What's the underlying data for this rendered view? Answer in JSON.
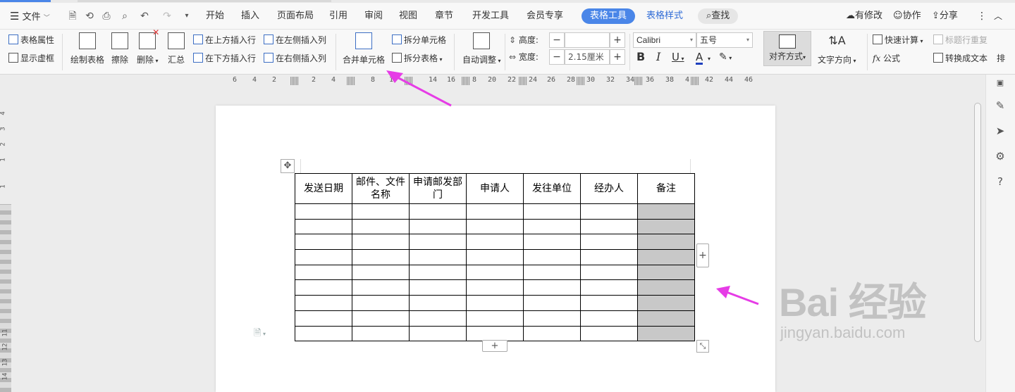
{
  "menubar": {
    "file": "文件",
    "tabs": [
      "开始",
      "插入",
      "页面布局",
      "引用",
      "审阅",
      "视图",
      "章节",
      "开发工具",
      "会员专享"
    ],
    "active_tab": "表格工具",
    "table_style_tab": "表格样式",
    "search": "查找",
    "right": {
      "modified": "有修改",
      "collab": "协作",
      "share": "分享"
    }
  },
  "ribbon": {
    "table_props": "表格属性",
    "show_grid": "显示虚框",
    "draw_table": "绘制表格",
    "erase": "擦除",
    "delete": "删除",
    "summary": "汇总",
    "insert_row_above": "在上方插入行",
    "insert_row_below": "在下方插入行",
    "insert_col_left": "在左侧插入列",
    "insert_col_right": "在右侧插入列",
    "merge_cells": "合并单元格",
    "split_cells": "拆分单元格",
    "split_table": "拆分表格",
    "auto_fit": "自动调整",
    "height_label": "高度:",
    "height_value": "",
    "width_label": "宽度:",
    "width_value": "2.15厘米",
    "font_name": "Calibri",
    "font_size": "五号",
    "align": "对齐方式",
    "text_dir": "文字方向",
    "quick_calc": "快速计算",
    "title_repeat": "标题行重复",
    "formula": "公式",
    "convert_text": "转换成文本",
    "more": "排"
  },
  "ruler_h": [
    "6",
    "4",
    "2",
    "2",
    "4",
    "8",
    "1",
    "14",
    "16",
    "8",
    "20",
    "22",
    "24",
    "26",
    "28",
    "30",
    "32",
    "34",
    "36",
    "38",
    "4",
    "42",
    "44",
    "46"
  ],
  "ruler_v": [
    "4",
    "3",
    "2",
    "1",
    "1",
    "11",
    "12",
    "13",
    "14"
  ],
  "table": {
    "headers": [
      "发送日期",
      "邮件、文件名称",
      "申请邮发部门",
      "申请人",
      "发往单位",
      "经办人",
      "备注"
    ],
    "row_count": 9
  },
  "watermark": {
    "logo": "Bai 经验",
    "url": "jingyan.baidu.com"
  },
  "colors": {
    "accent": "#4a86e8",
    "selected": "#c8c8c8",
    "arrow": "#e63ce6"
  }
}
